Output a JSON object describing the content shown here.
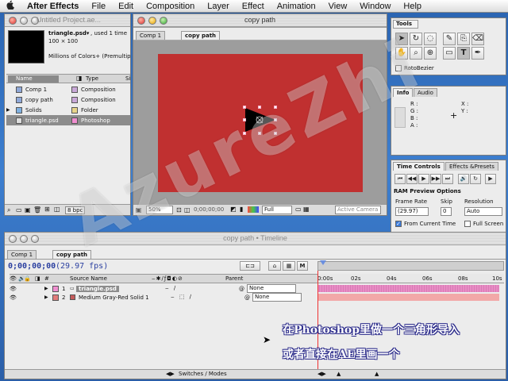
{
  "menubar": {
    "apple": "",
    "app_name": "After Effects",
    "items": [
      "File",
      "Edit",
      "Composition",
      "Layer",
      "Effect",
      "Animation",
      "View",
      "Window",
      "Help"
    ]
  },
  "project": {
    "title": "Untitled Project.ae...",
    "thumb_name": "triangle.psd▾",
    "thumb_used": ", used 1 time",
    "thumb_size": "100 × 100",
    "thumb_colors": "Millions of Colors+ (Premultiplie",
    "col_name": "Name",
    "col_type": "Type",
    "col_size": "Si",
    "items": [
      {
        "name": "Comp 1",
        "type": "Composition",
        "color": "#c9a8d8"
      },
      {
        "name": "copy path",
        "type": "Composition",
        "color": "#c9a8d8"
      },
      {
        "name": "Solids",
        "type": "Folder",
        "color": "#e8d48a"
      },
      {
        "name": "triangle.psd",
        "type": "Photoshop",
        "color": "#f08ed0"
      }
    ],
    "bpc": "8 bpc"
  },
  "comp_window": {
    "title": "copy path",
    "tabs": [
      "Comp 1",
      "copy path"
    ],
    "zoom": "50%",
    "timecode": "0;00;00;00",
    "resolution": "Full",
    "camera": "Active Camera",
    "bg_color": "#c03030"
  },
  "tools": {
    "title": "Tools",
    "rotobezier": "RotoBezier",
    "icons": [
      "selection-tool-icon",
      "hand-tool-icon",
      "rotate-tool-icon",
      "pen-tool-icon",
      "brush-tool-icon",
      "clone-tool-icon",
      "eraser-tool-icon",
      "zoom-tool-icon",
      "orbit-camera-icon",
      "rectangle-mask-icon",
      "text-tool-icon",
      "pen-tool-icon"
    ]
  },
  "info": {
    "tab_info": "Info",
    "tab_audio": "Audio",
    "r": "R :",
    "g": "G :",
    "b": "B :",
    "a": "A :",
    "x": "X :",
    "y": "Y :"
  },
  "time_controls": {
    "tab_time": "Time Controls",
    "tab_effects": "Effects &Presets",
    "ram_preview": "RAM Preview Options",
    "frame_rate_label": "Frame Rate",
    "frame_rate": "(29.97)",
    "skip_label": "Skip",
    "skip": "0",
    "resolution_label": "Resolution",
    "resolution": "Auto",
    "from_current": "From Current Time",
    "full_screen": "Full Screen"
  },
  "timeline": {
    "title": "copy path • Timeline",
    "tabs": [
      "Comp 1",
      "copy path"
    ],
    "timecode": "0;00;00;00",
    "fps": "(29.97 fps)",
    "col_source": "Source Name",
    "col_parent": "Parent",
    "ruler": [
      "0:00s",
      "02s",
      "04s",
      "06s",
      "08s",
      "10s"
    ],
    "layers": [
      {
        "num": "1",
        "name": "triangle.psd",
        "parent": "None",
        "color": "#f08ed0"
      },
      {
        "num": "2",
        "name": "Medium Gray-Red Solid 1",
        "parent": "None",
        "color": "#e27b7b"
      }
    ],
    "switches": "Switches / Modes"
  },
  "watermark": "AzureZhi",
  "captions": [
    "在Photoshop里做一个三角形导入",
    "或者直接在AE里画一个"
  ]
}
